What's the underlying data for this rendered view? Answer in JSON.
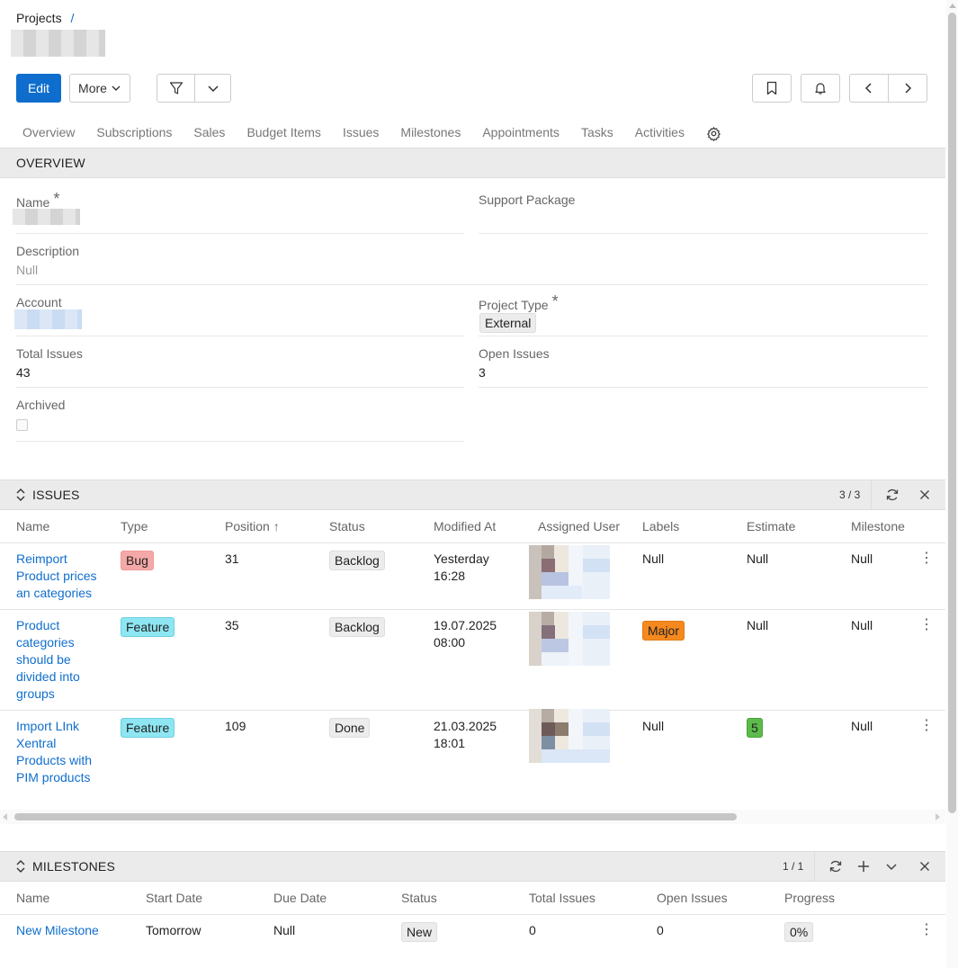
{
  "breadcrumb": {
    "root": "Projects",
    "sep": "/"
  },
  "toolbar": {
    "edit_label": "Edit",
    "more_label": "More"
  },
  "tabs": [
    "Overview",
    "Subscriptions",
    "Sales",
    "Budget Items",
    "Issues",
    "Milestones",
    "Appointments",
    "Tasks",
    "Activities"
  ],
  "overview": {
    "title": "OVERVIEW",
    "name_label": "Name",
    "support_package_label": "Support Package",
    "description_label": "Description",
    "description_value": "Null",
    "account_label": "Account",
    "project_type_label": "Project Type",
    "project_type_value": "External",
    "total_issues_label": "Total Issues",
    "total_issues_value": "43",
    "open_issues_label": "Open Issues",
    "open_issues_value": "3",
    "archived_label": "Archived"
  },
  "issues": {
    "title": "ISSUES",
    "count": "3 / 3",
    "columns": [
      "Name",
      "Type",
      "Position",
      "Status",
      "Modified At",
      "Assigned User",
      "Labels",
      "Estimate",
      "Milestone"
    ],
    "sort_indicator": "↑",
    "rows": [
      {
        "name": [
          "Reimport",
          "Product prices",
          "an categories"
        ],
        "type": "Bug",
        "position": "31",
        "status": "Backlog",
        "modified": [
          "Yesterday",
          "16:28"
        ],
        "labels": "Null",
        "estimate": "Null",
        "milestone": "Null"
      },
      {
        "name": [
          "Product",
          "categories",
          "should be",
          "divided into",
          "groups"
        ],
        "type": "Feature",
        "position": "35",
        "status": "Backlog",
        "modified": [
          "19.07.2025",
          "08:00"
        ],
        "labels": "Major",
        "estimate": "Null",
        "milestone": "Null"
      },
      {
        "name": [
          "Import LInk",
          "Xentral",
          "Products with",
          "PIM products"
        ],
        "type": "Feature",
        "position": "109",
        "status": "Done",
        "modified": [
          "21.03.2025",
          "18:01"
        ],
        "labels": "Null",
        "estimate": "5",
        "milestone": "Null"
      }
    ]
  },
  "milestones": {
    "title": "MILESTONES",
    "count": "1 / 1",
    "columns": [
      "Name",
      "Start Date",
      "Due Date",
      "Status",
      "Total Issues",
      "Open Issues",
      "Progress"
    ],
    "rows": [
      {
        "name": "New Milestone",
        "start": "Tomorrow",
        "due": "Null",
        "status": "New",
        "total": "0",
        "open": "0",
        "progress": "0%"
      }
    ]
  },
  "colors": {
    "accent": "#0f6ecd",
    "panel_header": "#ebebeb",
    "bug": "#f5a8a8",
    "feature": "#8ee6f3",
    "major": "#f5891f",
    "estimate": "#5cbb4b"
  }
}
